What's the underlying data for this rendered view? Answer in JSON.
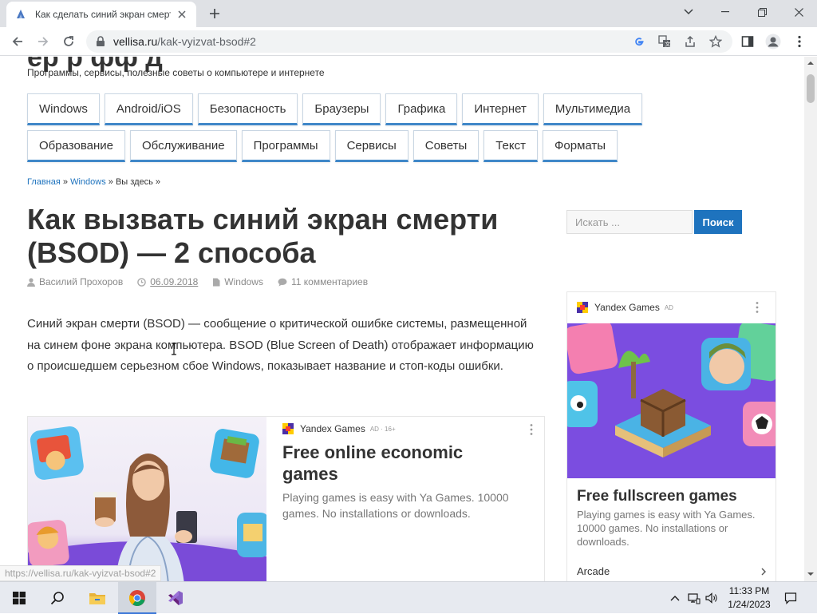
{
  "browser": {
    "tab_title": "Как сделать синий экран смерти",
    "url_domain": "vellisa.ru",
    "url_path": "/kak-vyizvat-bsod#2",
    "status_url": "https://vellisa.ru/kak-vyizvat-bsod#2"
  },
  "site": {
    "title_fragment": "ёр        р   фф      д",
    "tagline": "Программы, сервисы, полезные советы о компьютере и интернете"
  },
  "menu": {
    "row1": [
      "Windows",
      "Android/iOS",
      "Безопасность",
      "Браузеры",
      "Графика",
      "Интернет",
      "Мультимедиа"
    ],
    "row2": [
      "Образование",
      "Обслуживание",
      "Программы",
      "Сервисы",
      "Советы",
      "Текст",
      "Форматы"
    ]
  },
  "breadcrumb": {
    "home": "Главная",
    "sep1": " » ",
    "category": "Windows",
    "sep2": " » ",
    "current": "Вы здесь »"
  },
  "article": {
    "title": "Как вызвать синий экран смерти (BSOD) — 2 способа",
    "author": "Василий Прохоров",
    "date": "06.09.2018",
    "category": "Windows",
    "comments": "11 комментариев",
    "intro": "Синий экран смерти (BSOD) — сообщение о критической ошибке системы, размещенной на синем фоне экрана компьютера. BSOD (Blue Screen of Death) отображает информацию о происшедшем серьезном сбое Windows, показывает название и стоп-коды ошибки."
  },
  "ad_main": {
    "brand": "Yandex Games",
    "tag": "AD · 16+",
    "headline": "Free online economic games",
    "body": "Playing games is easy with Ya Games. 10000 games. No installations or downloads."
  },
  "search": {
    "placeholder": "Искать ...",
    "button": "Поиск"
  },
  "ad_side": {
    "brand": "Yandex Games",
    "tag": "AD",
    "headline": "Free fullscreen games",
    "body": "Playing games is easy with Ya Games. 10000 games. No installations or downloads.",
    "category": "Arcade"
  },
  "taskbar": {
    "time": "11:33 PM",
    "date": "1/24/2023"
  },
  "colors": {
    "accent": "#1e73be",
    "menu_underline": "#3f87c8",
    "ad_purple": "#7a4bd8"
  }
}
